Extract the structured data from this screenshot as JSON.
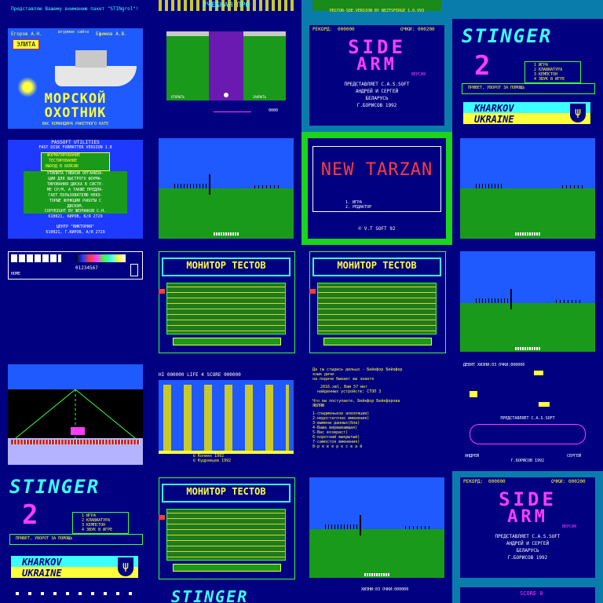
{
  "top_strip": {
    "left": "Представляю Вашему вниманию пакет \"STINgrol\"!",
    "mid": "УЧЕБНАЯ ПРО",
    "right": "PEGTOR-SDE.VERSION BY NEZTSFERGE 1.0.V93"
  },
  "tiles": {
    "morskoy": {
      "author_left": "Егоров А.Н.",
      "author_mid": "штурман сайта",
      "author_right": "Ефимов А.В.",
      "badge": "ЭЛИТА",
      "title1": "МОРСКОЙ",
      "title2": "ОХОТНИК",
      "footer": "ВАС КОМАНДИРА РАКЕТНОГО КАТЕ"
    },
    "elevator": {
      "left_label": "ОТКРЫТЬ",
      "right_label": "ЗАКРЫТЬ",
      "score": "0000"
    },
    "side_arm_a": {
      "record_label": "РЕКОРД:",
      "record_value": "000000",
      "score_label": "ОЧКИ:",
      "score_value": "000200",
      "logo1": "SIDE",
      "logo2": "ARM",
      "logo3": "ВЕРСИЯ",
      "line1": "ПРЕДСТАВЛЯЕТ С.А.S.SOFT",
      "line2": "АНДРЕЙ И СЕРГЕЙ",
      "line3": "БЕЛАРУСЬ",
      "line4": "Г.БОРИСОВ 1992"
    },
    "stinger_a": {
      "logo": "STINGER",
      "digit": "2",
      "menu1": "1 ИГРА",
      "menu2": "2 КЛАВИАТУРА",
      "menu3": "3 КЕМПСТОН",
      "menu4": "4 ЗВУК В ИГРЕ",
      "footer": "ПРИВЕТ, УВОРОТ ЗА ПОМОЩЬ",
      "city1": "KHARKOV",
      "city2": "UKRAINE"
    },
    "fdf": {
      "l1": "PASSOFT UTILITIES",
      "l2": "FAST DISK FORMATTER VERSION 1.0",
      "m1": "ФОРМАТИРОВАНИЕ",
      "m2": "ТЕСТИРОВАНИЕ",
      "m3": "ВЫХОД В БЕЙСИК",
      "b1": "УТИЛИТА ГИБКОЙ ОРГАНИЗА-",
      "b2": "ЦИИ ДЛЯ БЫСТРОГО ФОРМА-",
      "b3": "ТИРОВАНИЯ ДИСКА В СИСТЕ-",
      "b4": "МЕ СР/М, А ТАКЖЕ ПРЕДЛА-",
      "b5": "ГАЕТ ПОЛЬЗОВАТЕЛЮ НЕКО-",
      "b6": "ТОРЫЕ ФУНКЦИИ РАБОТЫ С",
      "b7": "ДИСКОМ.",
      "c1": "COPYRIGHT BY ЖЕРНАКОВ С.Н.",
      "c2": "610021, КИРОВ, К/Я 2729",
      "f1": "ЦЕНТР \"ВИКТОРИЯ\"",
      "f2": "610021, Г.КИРОВ, А/Я 2729"
    },
    "tarzan": {
      "title": "NEW TARZAN",
      "opt1": "1. ИГРА",
      "opt2": "2. РЕДАКТОР",
      "copyright": "© V.T SOFT 92"
    },
    "editor": {
      "counter": "01234567",
      "label": "НОМЕ"
    },
    "monitor_a": {
      "title": "МОНИТОР ТЕСТОВ"
    },
    "monitor_b": {
      "title": "МОНИТОР ТЕСТОВ"
    },
    "monitor_c": {
      "title": "МОНИТОР ТЕСТОВ"
    },
    "platform": {
      "hud": "HI 000000 LIFE 4 SCORE 000000",
      "credit1": "© Копиях 1992",
      "credit2": "© Кудрявцев 1992"
    },
    "basic_text": {
      "l1": "Да ты стыдись дельцо - Бейкфор Бейкфор",
      "l2": "язык дичи",
      "l3": "на подаче бывает вы знаете",
      "l4": "2016.xml, Вам 57 мет",
      "l5": "найденных устройств: СТОП 3",
      "l6": "Что вы поступаете, Бейкфор Бейкфорова",
      "l7": "ЯВЛЯЮ",
      "l8": "1-сладменькое апелляции)",
      "l9": "2-недостаточно вменения)",
      "l10": "3-вымени данных(бла)",
      "l11": "4-Ваша вирвывающая)",
      "l12": "5-Вас возвраст)",
      "l13": "6-короткий выкрытый)",
      "l14": "7-самостоя вменения)",
      "l15": "8-р е в е р к с в а й"
    },
    "side_arm_b": {
      "hud": "ДЕВЯТ  ХИЗНИ:03 ОЧКИ:000000",
      "line1": "ПРЕДСТАВЛЯЕТ С.А.S.SOFT",
      "left": "АНДРЕЙ",
      "right": "СЕРГЕЙ",
      "bottom": "Г.БОРИСОВ 1992"
    },
    "stinger_b": {
      "logo": "STINGER",
      "digit": "2",
      "menu1": "1 ИГРА",
      "menu2": "2 КЛАВИАТУРА",
      "menu3": "3 КЕМПСТОН",
      "menu4": "4 ЗВУК В ИГРЕ",
      "footer": "ПРИВЕТ, УВОРОТ ЗА ПОМОЩЬ",
      "city1": "KHARKOV",
      "city2": "UKRAINE"
    },
    "side_arm_c": {
      "record_label": "РЕКОРД:",
      "record_value": "000000",
      "score_label": "ОЧКИ:",
      "score_value": "000200",
      "logo1": "SIDE",
      "logo2": "ARM",
      "logo3": "ВЕРСИЯ",
      "line1": "ПРЕДСТАВЛЯЕТ С.А.S.SOFT",
      "line2": "АНДРЕЙ И СЕРГЕЙ",
      "line3": "БЕЛАРУСЬ",
      "line4": "Г.БОРИСОВ 1992"
    },
    "bottom_row": {
      "stinger": "STINGER",
      "hud": "ХИЗНИ:03 ОЧКИ:000000",
      "score": "SCORE 0"
    }
  }
}
